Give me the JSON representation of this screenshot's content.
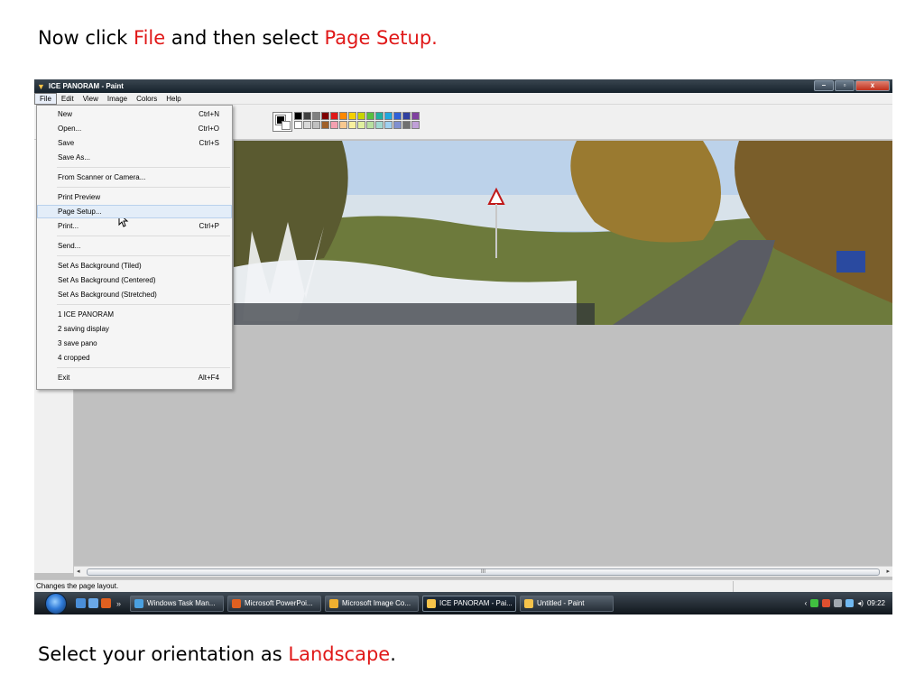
{
  "instructions": {
    "top": {
      "pre": "Now click ",
      "hl1": "File",
      "mid": " and then select ",
      "hl2": "Page Setup."
    },
    "bottom": {
      "pre": "Select your orientation as ",
      "hl": "Landscape",
      "post": "."
    }
  },
  "window": {
    "title": "ICE PANORAM - Paint",
    "app_icon": "paint-icon",
    "controls": {
      "minimize": "–",
      "maximize": "▫",
      "close": "x"
    }
  },
  "menubar": [
    "File",
    "Edit",
    "View",
    "Image",
    "Colors",
    "Help"
  ],
  "file_menu": {
    "items": [
      {
        "label": "New",
        "shortcut": "Ctrl+N"
      },
      {
        "label": "Open...",
        "shortcut": "Ctrl+O"
      },
      {
        "label": "Save",
        "shortcut": "Ctrl+S"
      },
      {
        "label": "Save As...",
        "shortcut": ""
      },
      {
        "label": "From Scanner or Camera...",
        "shortcut": ""
      },
      {
        "label": "Print Preview",
        "shortcut": ""
      },
      {
        "label": "Page Setup...",
        "shortcut": ""
      },
      {
        "label": "Print...",
        "shortcut": "Ctrl+P"
      },
      {
        "label": "Send...",
        "shortcut": ""
      },
      {
        "label": "Set As Background (Tiled)",
        "shortcut": ""
      },
      {
        "label": "Set As Background (Centered)",
        "shortcut": ""
      },
      {
        "label": "Set As Background (Stretched)",
        "shortcut": ""
      },
      {
        "label": "1 ICE PANORAM",
        "shortcut": ""
      },
      {
        "label": "2 saving display",
        "shortcut": ""
      },
      {
        "label": "3 save pano",
        "shortcut": ""
      },
      {
        "label": "4 cropped",
        "shortcut": ""
      },
      {
        "label": "Exit",
        "shortcut": "Alt+F4"
      }
    ],
    "highlighted": "Page Setup..."
  },
  "palette": {
    "row1": [
      "#000000",
      "#404040",
      "#808080",
      "#7f0000",
      "#e01818",
      "#ff8800",
      "#f5d000",
      "#c8d400",
      "#58c040",
      "#20b0a0",
      "#20a8e0",
      "#3060d8",
      "#3040a0",
      "#8040a0"
    ],
    "row2": [
      "#ffffff",
      "#d8d8d8",
      "#c0c0c0",
      "#a0602a",
      "#f4a0b0",
      "#f8c890",
      "#f8f0a0",
      "#e0f0a0",
      "#b8e0a0",
      "#a0d8d0",
      "#a0d0f0",
      "#8090d0",
      "#707070",
      "#c0a0d8"
    ]
  },
  "status": {
    "text": "Changes the page layout."
  },
  "scroll_grip": "III",
  "taskbar": {
    "ql_more": "»",
    "buttons": [
      {
        "label": "Windows Task Man...",
        "color": "#4aa0e0"
      },
      {
        "label": "Microsoft PowerPoi...",
        "color": "#e06020"
      },
      {
        "label": "Microsoft Image Co...",
        "color": "#f0b030"
      },
      {
        "label": "ICE PANORAM - Pai...",
        "color": "#f6c34a",
        "active": true
      },
      {
        "label": "Untitled - Paint",
        "color": "#f6c34a"
      }
    ],
    "clock": "09:22"
  }
}
